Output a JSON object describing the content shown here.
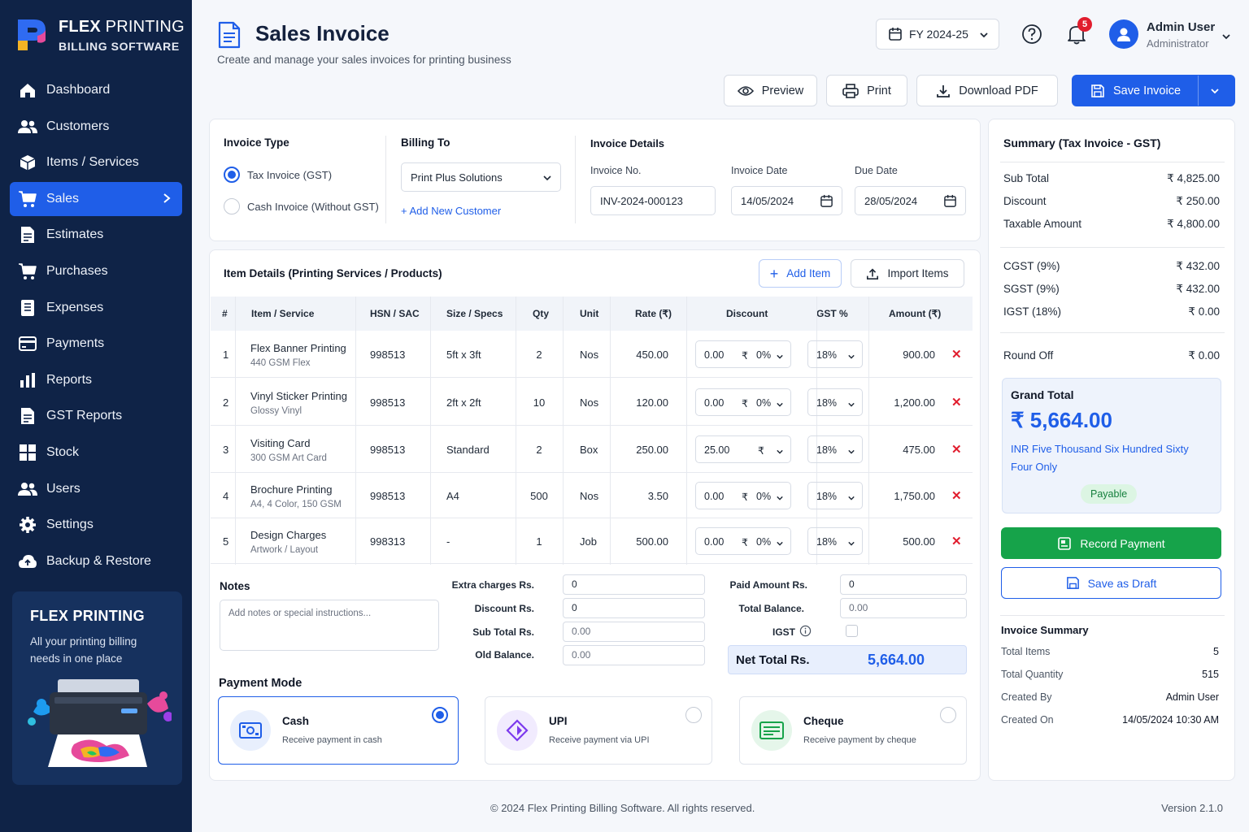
{
  "brand": {
    "name_bold": "FLEX",
    "name_rest": " PRINTING",
    "subtitle": "BILLING SOFTWARE"
  },
  "nav": [
    {
      "label": "Dashboard",
      "icon": "home-icon"
    },
    {
      "label": "Customers",
      "icon": "users-icon"
    },
    {
      "label": "Items / Services",
      "icon": "box-icon"
    },
    {
      "label": "Sales",
      "icon": "cart-icon",
      "active": true
    },
    {
      "label": "Estimates",
      "icon": "document-icon"
    },
    {
      "label": "Purchases",
      "icon": "cart-icon"
    },
    {
      "label": "Expenses",
      "icon": "ledger-icon"
    },
    {
      "label": "Payments",
      "icon": "card-icon"
    },
    {
      "label": "Reports",
      "icon": "bar-chart-icon"
    },
    {
      "label": "GST Reports",
      "icon": "document-icon"
    },
    {
      "label": "Stock",
      "icon": "stock-icon"
    },
    {
      "label": "Users",
      "icon": "users-icon"
    },
    {
      "label": "Settings",
      "icon": "gear-icon"
    },
    {
      "label": "Backup & Restore",
      "icon": "cloud-upload-icon"
    }
  ],
  "promo": {
    "title": "FLEX PRINTING",
    "text": "All your printing billing needs in one place"
  },
  "header": {
    "title": "Sales Invoice",
    "subtitle": "Create and manage your sales invoices for printing business",
    "fy": "FY 2024-25",
    "notifications": "5",
    "user_name": "Admin User",
    "user_role": "Administrator"
  },
  "actions": {
    "preview": "Preview",
    "print": "Print",
    "download": "Download PDF",
    "save": "Save Invoice"
  },
  "invoice": {
    "type_label": "Invoice Type",
    "type_gst": "Tax Invoice (GST)",
    "type_cash": "Cash Invoice (Without GST)",
    "billing_label": "Billing To",
    "customer": "Print Plus Solutions",
    "add_customer": "+ Add New Customer",
    "details_label": "Invoice Details",
    "no_label": "Invoice No.",
    "no": "INV-2024-000123",
    "date_label": "Invoice Date",
    "date": "14/05/2024",
    "due_label": "Due Date",
    "due": "28/05/2024"
  },
  "items": {
    "title": "Item Details (Printing Services / Products)",
    "add_item": "Add Item",
    "import_items": "Import Items",
    "columns": [
      "#",
      "Item / Service",
      "HSN / SAC",
      "Size / Specs",
      "Qty",
      "Unit",
      "Rate (₹)",
      "Discount",
      "GST %",
      "Amount (₹)"
    ],
    "rows": [
      {
        "n": "1",
        "name": "Flex Banner Printing",
        "desc": "440 GSM Flex",
        "hsn": "998513",
        "size": "5ft x 3ft",
        "qty": "2",
        "unit": "Nos",
        "rate": "450.00",
        "disc": "0.00",
        "disc_cur": "₹",
        "disc_pct": "0%",
        "gst": "18%",
        "amount": "900.00"
      },
      {
        "n": "2",
        "name": "Vinyl Sticker Printing",
        "desc": "Glossy Vinyl",
        "hsn": "998513",
        "size": "2ft x 2ft",
        "qty": "10",
        "unit": "Nos",
        "rate": "120.00",
        "disc": "0.00",
        "disc_cur": "₹",
        "disc_pct": "0%",
        "gst": "18%",
        "amount": "1,200.00"
      },
      {
        "n": "3",
        "name": "Visiting Card",
        "desc": "300 GSM Art Card",
        "hsn": "998513",
        "size": "Standard",
        "qty": "2",
        "unit": "Box",
        "rate": "250.00",
        "disc": "25.00",
        "disc_cur": "₹",
        "disc_pct": "",
        "gst": "18%",
        "amount": "475.00"
      },
      {
        "n": "4",
        "name": "Brochure Printing",
        "desc": "A4, 4 Color, 150 GSM",
        "hsn": "998513",
        "size": "A4",
        "qty": "500",
        "unit": "Nos",
        "rate": "3.50",
        "disc": "0.00",
        "disc_cur": "₹",
        "disc_pct": "0%",
        "gst": "18%",
        "amount": "1,750.00"
      },
      {
        "n": "5",
        "name": "Design Charges",
        "desc": "Artwork / Layout",
        "hsn": "998313",
        "size": "-",
        "qty": "1",
        "unit": "Job",
        "rate": "500.00",
        "disc": "0.00",
        "disc_cur": "₹",
        "disc_pct": "0%",
        "gst": "18%",
        "amount": "500.00"
      }
    ]
  },
  "bottom": {
    "notes_label": "Notes",
    "notes_placeholder": "Add notes or special instructions...",
    "extra_label": "Extra charges Rs.",
    "extra": "0",
    "discount_label": "Discount Rs.",
    "discount": "0",
    "subtotal_label": "Sub Total Rs.",
    "subtotal": "0.00",
    "old_label": "Old Balance.",
    "old": "0.00",
    "paid_label": "Paid Amount Rs.",
    "paid": "0",
    "total_bal_label": "Total Balance.",
    "total_bal": "0.00",
    "igst_label": "IGST",
    "net_label": "Net Total Rs.",
    "net": "5,664.00"
  },
  "payment": {
    "label": "Payment Mode",
    "modes": [
      {
        "title": "Cash",
        "sub": "Receive payment in cash",
        "icon": "cash-icon",
        "selected": true
      },
      {
        "title": "UPI",
        "sub": "Receive payment via UPI",
        "icon": "upi-icon",
        "selected": false
      },
      {
        "title": "Cheque",
        "sub": "Receive payment by cheque",
        "icon": "cheque-icon",
        "selected": false
      }
    ]
  },
  "summary": {
    "title": "Summary (Tax Invoice - GST)",
    "rows1": [
      {
        "label": "Sub Total",
        "value": "₹ 4,825.00"
      },
      {
        "label": "Discount",
        "value": "₹ 250.00"
      },
      {
        "label": "Taxable Amount",
        "value": "₹ 4,800.00"
      }
    ],
    "rows2": [
      {
        "label": "CGST (9%)",
        "value": "₹ 432.00"
      },
      {
        "label": "SGST (9%)",
        "value": "₹ 432.00"
      },
      {
        "label": "IGST (18%)",
        "value": "₹ 0.00"
      }
    ],
    "round_label": "Round Off",
    "round": "₹ 0.00",
    "grand_label": "Grand Total",
    "grand": "₹ 5,664.00",
    "words": "INR Five Thousand Six Hundred Sixty Four Only",
    "status": "Payable",
    "record": "Record Payment",
    "draft": "Save as Draft",
    "inv_sum_label": "Invoice Summary",
    "inv_rows": [
      {
        "label": "Total Items",
        "value": "5"
      },
      {
        "label": "Total Quantity",
        "value": "515"
      },
      {
        "label": "Created By",
        "value": "Admin User"
      },
      {
        "label": "Created On",
        "value": "14/05/2024 10:30 AM"
      }
    ]
  },
  "footer": {
    "copyright": "© 2024 Flex Printing Billing Software. All rights reserved.",
    "version": "Version 2.1.0"
  },
  "colors": {
    "sidebar": "#0f2347",
    "accent": "#1f5ee8",
    "success": "#16a34a",
    "danger": "#e11d2e"
  }
}
